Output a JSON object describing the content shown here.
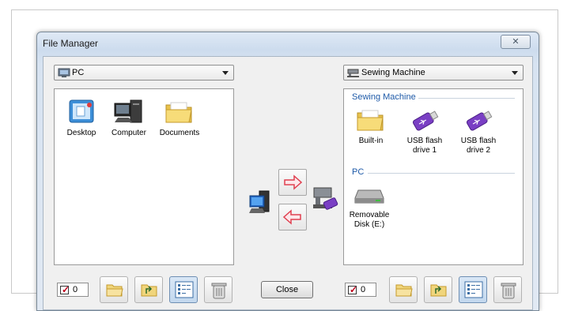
{
  "window": {
    "title": "File Manager",
    "close_glyph": "✕"
  },
  "left": {
    "source_label": "PC",
    "items": [
      {
        "label": "Desktop",
        "icon": "desktop-icon"
      },
      {
        "label": "Computer",
        "icon": "computer-icon"
      },
      {
        "label": "Documents",
        "icon": "folder-icon"
      }
    ],
    "count": "0"
  },
  "right": {
    "source_label": "Sewing Machine",
    "groups": [
      {
        "title": "Sewing Machine",
        "items": [
          {
            "label": "Built-in",
            "icon": "folder-icon"
          },
          {
            "label": "USB flash drive 1",
            "icon": "usb-drive-icon"
          },
          {
            "label": "USB flash drive 2",
            "icon": "usb-drive-icon"
          }
        ]
      },
      {
        "title": "PC",
        "items": [
          {
            "label": "Removable Disk (E:)",
            "icon": "removable-disk-icon"
          }
        ]
      }
    ],
    "count": "0"
  },
  "buttons": {
    "close_label": "Close"
  },
  "colors": {
    "accent": "#1e5aa8",
    "arrow": "#e04050",
    "usb": "#7a3fc4"
  }
}
